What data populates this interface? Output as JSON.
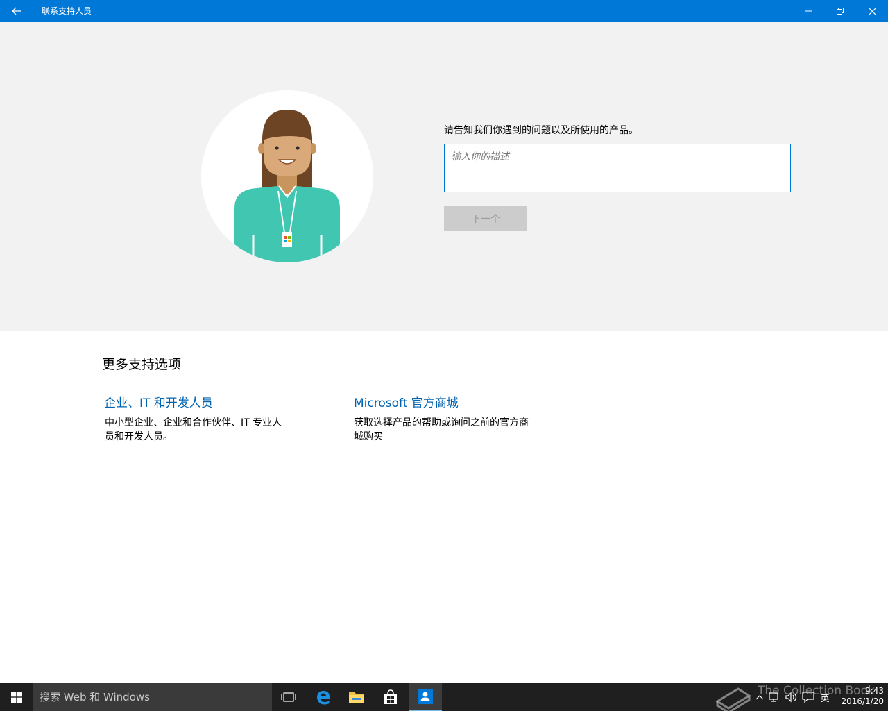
{
  "titlebar": {
    "title": "联系支持人员"
  },
  "hero": {
    "prompt": "请告知我们你遇到的问题以及所使用的产品。",
    "description_placeholder": "输入你的描述",
    "description_value": "",
    "next_label": "下一个"
  },
  "more_options": {
    "title": "更多支持选项",
    "items": [
      {
        "link": "企业、IT 和开发人员",
        "desc": "中小型企业、企业和合作伙伴、IT 专业人员和开发人员。"
      },
      {
        "link": "Microsoft 官方商城",
        "desc": "获取选择产品的帮助或询问之前的官方商城购买"
      }
    ]
  },
  "taskbar": {
    "search_placeholder": "搜索 Web 和 Windows",
    "ime": "英",
    "time": "9:43",
    "date": "2016/1/20"
  },
  "watermark": "The Collection Book",
  "colors": {
    "accent": "#0078d7",
    "link": "#0063b1",
    "hero_bg": "#f2f2f2",
    "avatar_shirt": "#41c6b2",
    "avatar_hair": "#6d4424",
    "avatar_skin": "#d9a97a"
  }
}
